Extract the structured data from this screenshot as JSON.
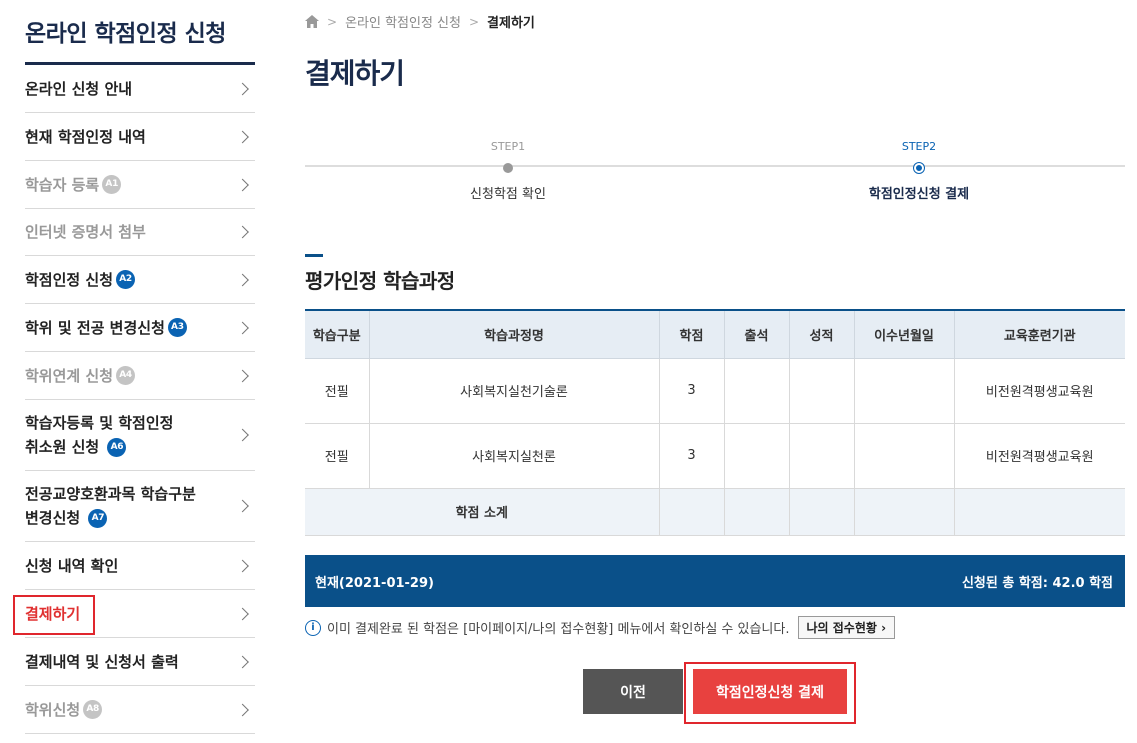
{
  "sidebar": {
    "title": "온라인 학점인정 신청",
    "items": [
      {
        "label": "온라인 신청 안내",
        "badge": "",
        "disabled": false
      },
      {
        "label": "현재 학점인정 내역",
        "badge": "",
        "disabled": false
      },
      {
        "label": "학습자 등록",
        "badge": "A1",
        "disabled": true
      },
      {
        "label": "인터넷 증명서 첨부",
        "badge": "",
        "disabled": true
      },
      {
        "label": "학점인정 신청",
        "badge": "A2",
        "disabled": false
      },
      {
        "label": "학위 및 전공 변경신청",
        "badge": "A3",
        "disabled": false
      },
      {
        "label": "학위연계 신청",
        "badge": "A4",
        "disabled": true
      },
      {
        "label_line1": "학습자등록 및 학점인정",
        "label_line2": "취소원 신청",
        "badge": "A6",
        "disabled": false
      },
      {
        "label_line1": "전공교양호환과목 학습구분",
        "label_line2": "변경신청",
        "badge": "A7",
        "disabled": false
      },
      {
        "label": "신청 내역 확인",
        "badge": "",
        "disabled": false
      },
      {
        "label": "결제하기",
        "badge": "",
        "disabled": false,
        "active": true
      },
      {
        "label": "결제내역 및 신청서 출력",
        "badge": "",
        "disabled": false
      },
      {
        "label": "학위신청",
        "badge": "A8",
        "disabled": true
      }
    ]
  },
  "breadcrumb": {
    "home_icon": "home-icon",
    "items": [
      "온라인 학점인정 신청",
      "결제하기"
    ]
  },
  "page_title": "결제하기",
  "steps": [
    {
      "num": "STEP1",
      "label": "신청학점 확인",
      "current": false
    },
    {
      "num": "STEP2",
      "label": "학점인정신청 결제",
      "current": true
    }
  ],
  "section_title": "평가인정 학습과정",
  "table": {
    "headers": [
      "학습구분",
      "학습과정명",
      "학점",
      "출석",
      "성적",
      "이수년월일",
      "교육훈련기관"
    ],
    "rows": [
      [
        "전필",
        "사회복지실천기술론",
        "3",
        "",
        "",
        "",
        "비전원격평생교육원"
      ],
      [
        "전필",
        "사회복지실천론",
        "3",
        "",
        "",
        "",
        "비전원격평생교육원"
      ]
    ],
    "subtotal_label": "학점 소계"
  },
  "total_bar": {
    "date_label": "현재(2021-01-29)",
    "total_label": "신청된 총 학점: 42.0 학점"
  },
  "notice": {
    "text": "이미 결제완료 된 학점은 [마이페이지/나의 접수현황] 메뉴에서 확인하실 수 있습니다.",
    "button_label": "나의 접수현황"
  },
  "buttons": {
    "prev_label": "이전",
    "pay_label": "학점인정신청 결제"
  },
  "colors": {
    "navy": "#1a2b4c",
    "primary_blue": "#0a5089",
    "badge_blue": "#0a63b3",
    "highlight_red": "#e0262d",
    "pay_red": "#e8413f"
  }
}
